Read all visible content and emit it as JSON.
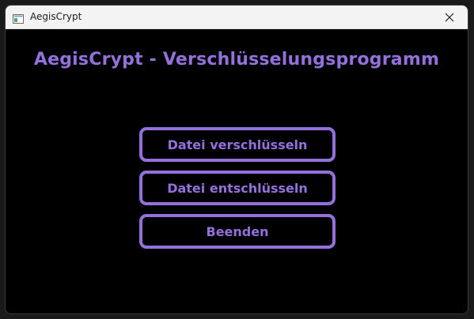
{
  "window": {
    "title": "AegisCrypt",
    "icons": {
      "app": "app-window-icon",
      "close": "close-icon"
    }
  },
  "main": {
    "heading": "AegisCrypt - Verschlüsselungsprogramm",
    "buttons": [
      {
        "label": "Datei verschlüsseln"
      },
      {
        "label": "Datei entschlüsseln"
      },
      {
        "label": "Beenden"
      }
    ]
  },
  "colors": {
    "accent": "#9370db",
    "background": "#000000",
    "titlebar": "#f3f3f3"
  }
}
